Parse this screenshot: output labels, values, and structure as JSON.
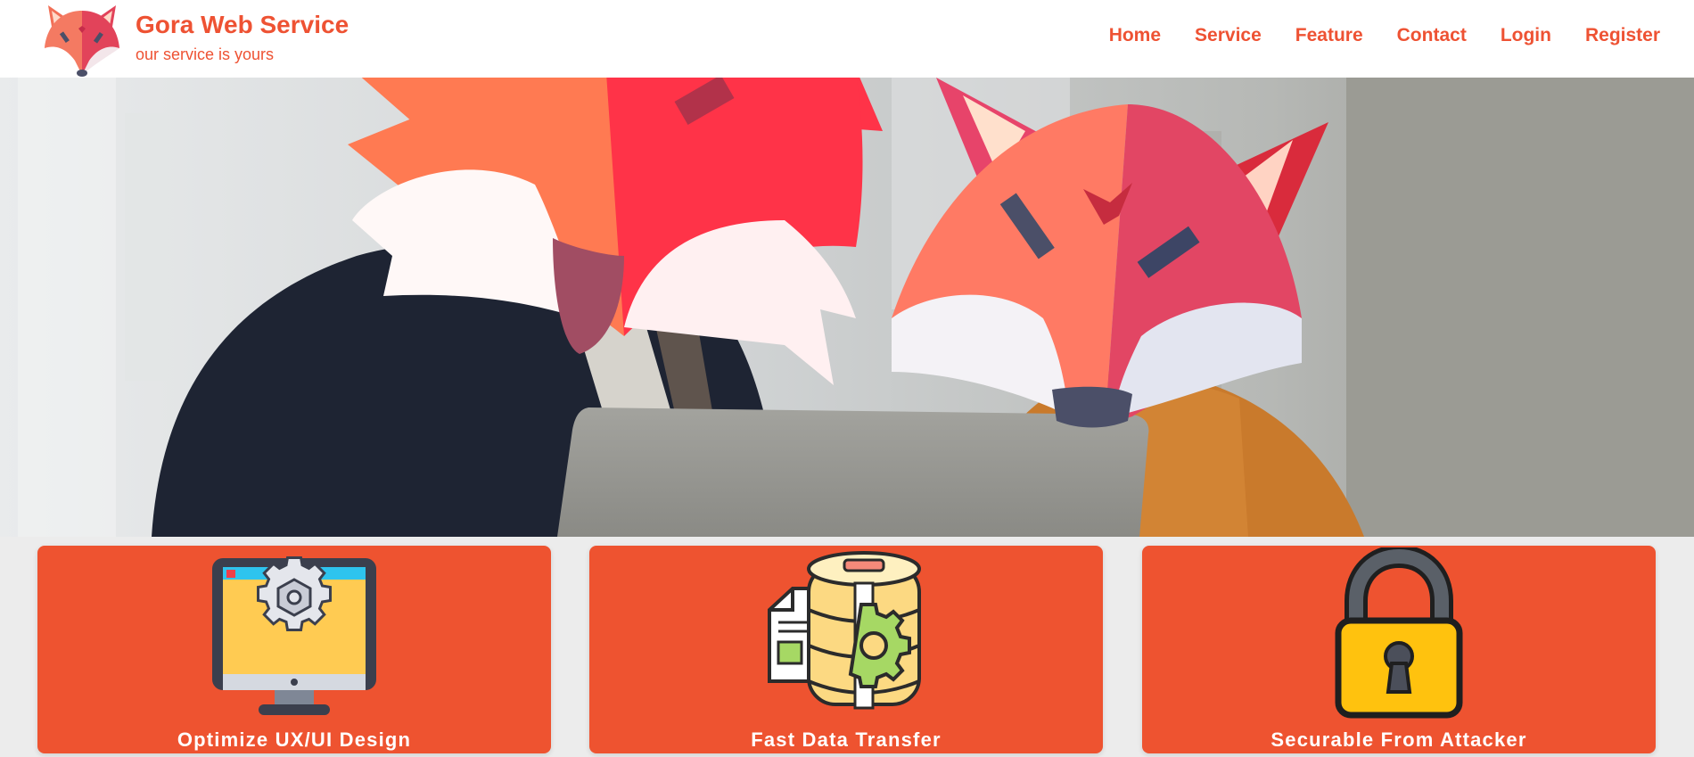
{
  "brand": {
    "title": "Gora Web Service",
    "subtitle": "our service is yours",
    "logo_icon": "fox-logo-icon"
  },
  "nav": {
    "items": [
      {
        "label": "Home"
      },
      {
        "label": "Service"
      },
      {
        "label": "Feature"
      },
      {
        "label": "Contact"
      },
      {
        "label": "Login"
      },
      {
        "label": "Register"
      }
    ]
  },
  "hero": {
    "image": "office-workers-with-fox-masks-image"
  },
  "features": [
    {
      "label": "Optimize UX/UI Design",
      "icon": "monitor-gear-icon"
    },
    {
      "label": "Fast Data Transfer",
      "icon": "database-gear-icon"
    },
    {
      "label": "Securable From Attacker",
      "icon": "padlock-icon"
    }
  ],
  "colors": {
    "accent": "#ee5233",
    "card": "#ee5330",
    "navbar_bg": "#ffffff",
    "page_bg": "#ececec"
  }
}
